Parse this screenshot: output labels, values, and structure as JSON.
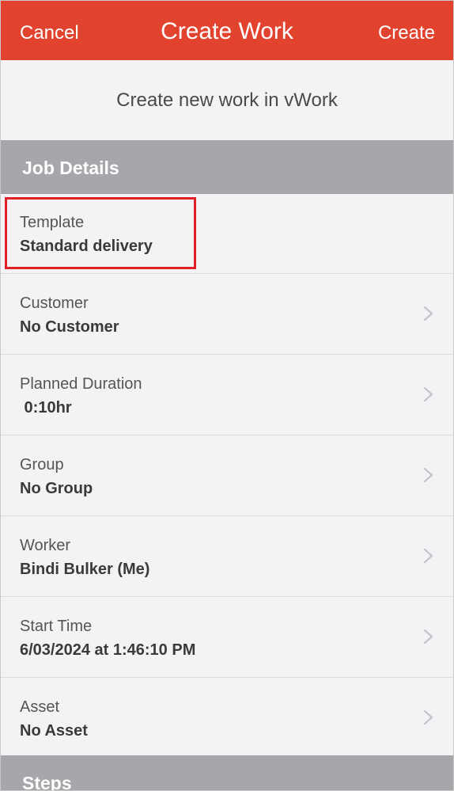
{
  "navbar": {
    "cancel_label": "Cancel",
    "title": "Create Work",
    "create_label": "Create"
  },
  "subtitle": "Create new work in vWork",
  "sections": {
    "job_details": "Job Details",
    "steps": "Steps"
  },
  "fields": [
    {
      "label": "Template",
      "value": "Standard delivery",
      "chevron": false
    },
    {
      "label": "Customer",
      "value": "No Customer",
      "chevron": true
    },
    {
      "label": "Planned Duration",
      "value": " 0:10hr",
      "chevron": true
    },
    {
      "label": "Group",
      "value": "No Group",
      "chevron": true
    },
    {
      "label": "Worker",
      "value": "Bindi Bulker (Me)",
      "chevron": true
    },
    {
      "label": "Start Time",
      "value": "6/03/2024 at 1:46:10 PM",
      "chevron": true
    },
    {
      "label": "Asset",
      "value": "No Asset",
      "chevron": true
    }
  ],
  "colors": {
    "navbar": "#e2432e",
    "section_header": "#a7a6ab",
    "background": "#f4f2f4",
    "highlight": "#e01f26"
  },
  "icons": {
    "row_disclosure": "chevron-right-icon"
  }
}
